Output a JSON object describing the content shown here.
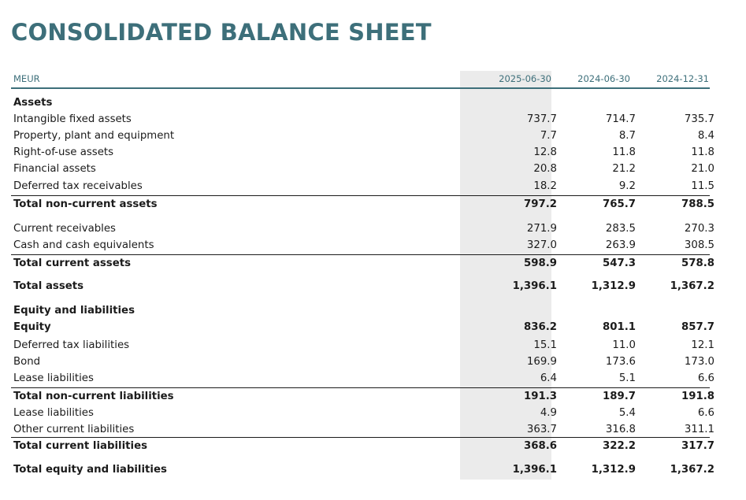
{
  "title": "CONSOLIDATED BALANCE SHEET",
  "header": {
    "unit": "MEUR",
    "columns": [
      "2025-06-30",
      "2024-06-30",
      "2024-12-31"
    ]
  },
  "rows": [
    {
      "label": "Assets",
      "values": [
        "",
        "",
        ""
      ]
    },
    {
      "label": "Intangible fixed assets",
      "values": [
        "737.7",
        "714.7",
        "735.7"
      ]
    },
    {
      "label": "Property, plant and equipment",
      "values": [
        "7.7",
        "8.7",
        "8.4"
      ]
    },
    {
      "label": "Right-of-use assets",
      "values": [
        "12.8",
        "11.8",
        "11.8"
      ]
    },
    {
      "label": "Financial assets",
      "values": [
        "20.8",
        "21.2",
        "21.0"
      ]
    },
    {
      "label": "Deferred tax receivables",
      "values": [
        "18.2",
        "9.2",
        "11.5"
      ]
    },
    {
      "label": "Total non-current assets",
      "values": [
        "797.2",
        "765.7",
        "788.5"
      ]
    },
    {
      "label": "Current receivables",
      "values": [
        "271.9",
        "283.5",
        "270.3"
      ]
    },
    {
      "label": "Cash and cash equivalents",
      "values": [
        "327.0",
        "263.9",
        "308.5"
      ]
    },
    {
      "label": "Total current assets",
      "values": [
        "598.9",
        "547.3",
        "578.8"
      ]
    },
    {
      "label": "Total assets",
      "values": [
        "1,396.1",
        "1,312.9",
        "1,367.2"
      ]
    },
    {
      "label": "Equity and liabilities",
      "values": [
        "",
        "",
        ""
      ]
    },
    {
      "label": "Equity",
      "values": [
        "836.2",
        "801.1",
        "857.7"
      ]
    },
    {
      "label": "Deferred tax liabilities",
      "values": [
        "15.1",
        "11.0",
        "12.1"
      ]
    },
    {
      "label": "Bond",
      "values": [
        "169.9",
        "173.6",
        "173.0"
      ]
    },
    {
      "label": "Lease liabilities",
      "values": [
        "6.4",
        "5.1",
        "6.6"
      ]
    },
    {
      "label": "Total non-current liabilities",
      "values": [
        "191.3",
        "189.7",
        "191.8"
      ]
    },
    {
      "label": "Lease liabilities",
      "values": [
        "4.9",
        "5.4",
        "6.6"
      ]
    },
    {
      "label": "Other current liabilities",
      "values": [
        "363.7",
        "316.8",
        "311.1"
      ]
    },
    {
      "label": "Total current liabilities",
      "values": [
        "368.6",
        "322.2",
        "317.7"
      ]
    },
    {
      "label": "Total equity and liabilities",
      "values": [
        "1,396.1",
        "1,312.9",
        "1,367.2"
      ]
    }
  ]
}
